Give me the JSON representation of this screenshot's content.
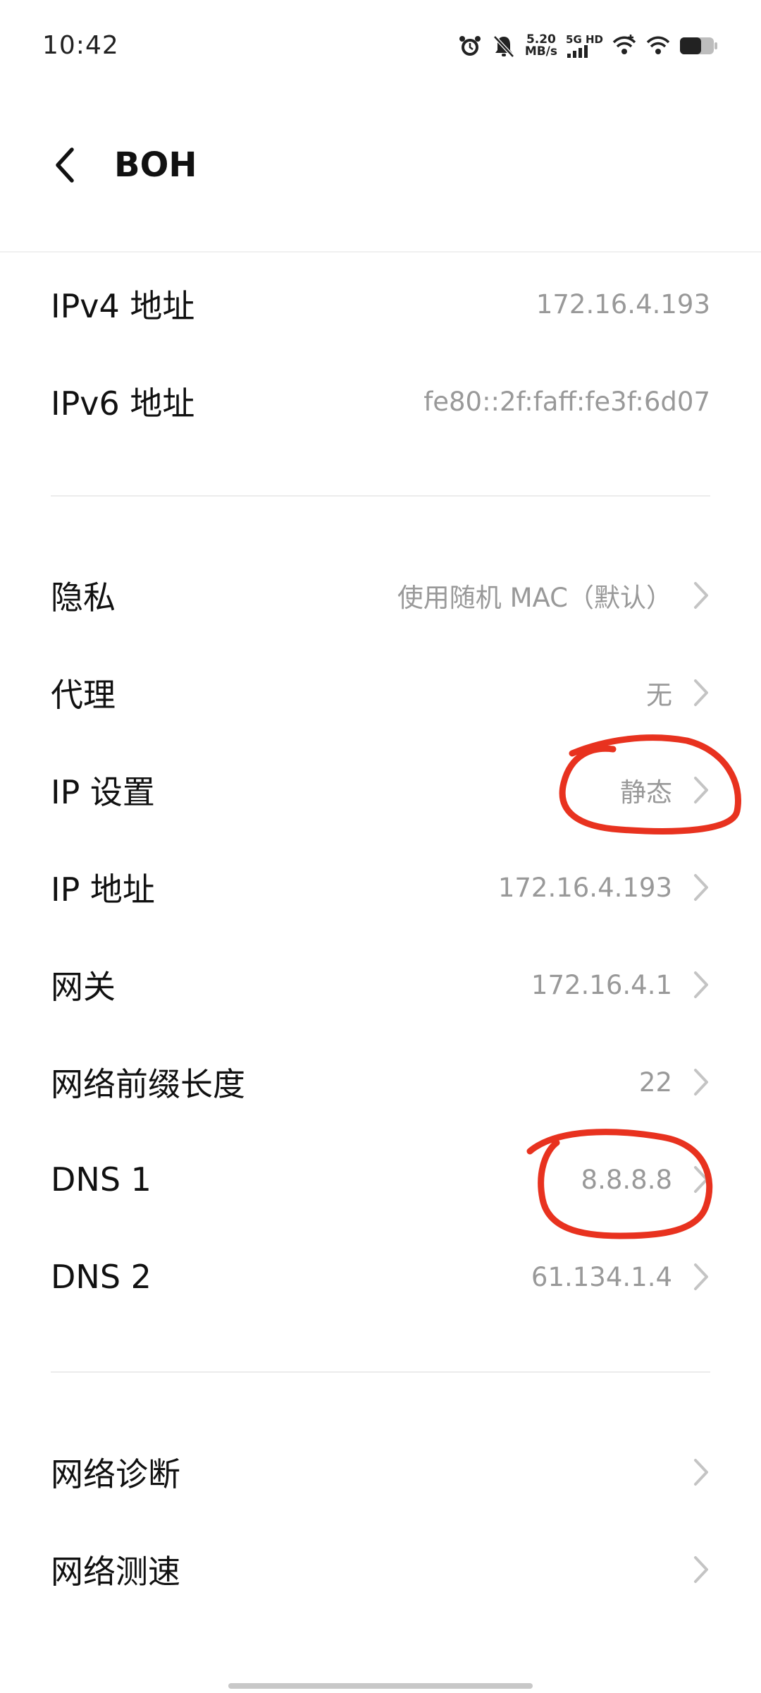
{
  "status_bar": {
    "time": "10:42",
    "speed_value": "5.20",
    "speed_unit": "MB/s",
    "net_label_top": "5G HD",
    "icons": [
      "alarm-icon",
      "bell-muted-icon",
      "signal-bars-icon",
      "wifi-plus-icon",
      "wifi-icon",
      "battery-icon"
    ]
  },
  "header": {
    "back_icon": "back-chevron-icon",
    "title": "BOH"
  },
  "ip_info": [
    {
      "label": "IPv4 地址",
      "value": "172.16.4.193"
    },
    {
      "label": "IPv6 地址",
      "value": "fe80::2f:faff:fe3f:6d07"
    }
  ],
  "settings": [
    {
      "label": "隐私",
      "value": "使用随机 MAC（默认）"
    },
    {
      "label": "代理",
      "value": "无"
    },
    {
      "label": "IP 设置",
      "value": "静态"
    },
    {
      "label": "IP 地址",
      "value": "172.16.4.193"
    },
    {
      "label": "网关",
      "value": "172.16.4.1"
    },
    {
      "label": "网络前缀长度",
      "value": "22"
    },
    {
      "label": "DNS 1",
      "value": "8.8.8.8"
    },
    {
      "label": "DNS 2",
      "value": "61.134.1.4"
    }
  ],
  "tools": [
    {
      "label": "网络诊断"
    },
    {
      "label": "网络测速"
    }
  ],
  "colors": {
    "annotation_red": "#e8321f",
    "secondary_text": "#999999",
    "chevron": "#c4c4c4"
  }
}
